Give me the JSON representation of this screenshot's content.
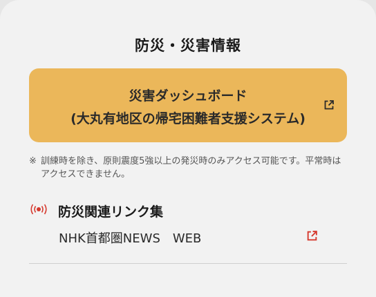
{
  "section": {
    "title": "防災・災害情報"
  },
  "dashboard": {
    "line1": "災害ダッシュボード",
    "line2": "(大丸有地区の帰宅困難者支援システム)",
    "icon": "external-link-icon",
    "background_color": "#ebb75a"
  },
  "note": {
    "mark": "※",
    "text": "訓練時を除き、原則震度5強以上の発災時のみアクセス可能です。平常時はアクセスできません。"
  },
  "links": {
    "icon": "broadcast-signal-icon",
    "title": "防災関連リンク集",
    "items": [
      {
        "label": "NHK首都圏NEWS　WEB",
        "icon": "external-link-icon",
        "icon_color": "#d63a2f"
      }
    ]
  }
}
